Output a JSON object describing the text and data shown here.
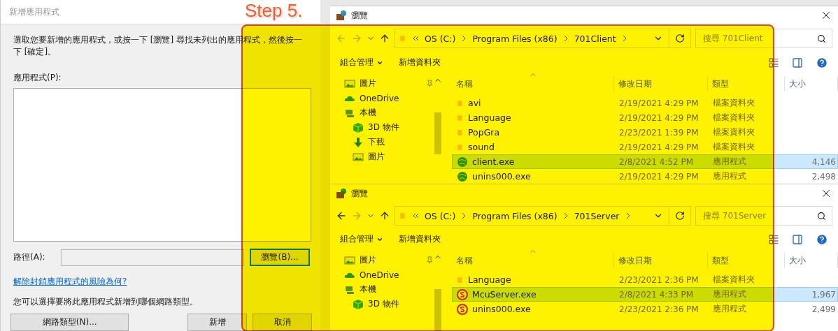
{
  "step_label": "Step 5.",
  "dialog": {
    "title": "新增應用程式",
    "instructions": "選取您要新增的應用程式，或按一下 [瀏覽] 尋找未列出的應用程式，然後按一下 [確定]。",
    "list_label": "應用程式(P):",
    "path_label": "路徑(A):",
    "browse_button": {
      "label": "瀏覽(B)...",
      "focused": true
    },
    "link": "解除封鎖應用程式的風險為何?",
    "network_note": "您可以選擇要將此應用程式新增到哪個網路類型。",
    "buttons": [
      "網路類型(N)...",
      "新增",
      "取消"
    ]
  },
  "explorers": [
    {
      "title": "瀏覽",
      "back_enabled": false,
      "breadcrumb": [
        "OS (C:)",
        "Program Files (x86)",
        "701Client"
      ],
      "search_placeholder": "搜尋 701Client",
      "toolbar": [
        "組合管理",
        "新增資料夾"
      ],
      "nav_items": [
        {
          "label": "圖片",
          "kind": "pictures",
          "pinned": true
        },
        {
          "label": "OneDrive",
          "kind": "cloud",
          "pinned": false
        },
        {
          "label": "本機",
          "kind": "pc",
          "pinned": false
        },
        {
          "label": "3D 物件",
          "kind": "cube",
          "pinned": false
        },
        {
          "label": "下載",
          "kind": "download",
          "pinned": false
        },
        {
          "label": "圖片",
          "kind": "pictures",
          "pinned": false
        }
      ],
      "columns": [
        "名稱",
        "修改日期",
        "類型",
        "大小"
      ],
      "rows": [
        {
          "name": "avi",
          "modified": "2/19/2021 4:29 PM",
          "type": "檔案資料夾",
          "kind": "folder",
          "selected": false
        },
        {
          "name": "Language",
          "modified": "2/19/2021 4:29 PM",
          "type": "檔案資料夾",
          "kind": "folder",
          "selected": false
        },
        {
          "name": "PopGra",
          "modified": "2/23/2021 1:39 PM",
          "type": "檔案資料夾",
          "kind": "folder",
          "selected": false
        },
        {
          "name": "sound",
          "modified": "2/19/2021 4:29 PM",
          "type": "檔案資料夾",
          "kind": "folder",
          "selected": false
        },
        {
          "name": "client.exe",
          "modified": "2/8/2021 4:52 PM",
          "type": "應用程式",
          "size": "4,146",
          "kind": "globe",
          "selected": true
        },
        {
          "name": "unins000.exe",
          "modified": "2/19/2021 4:29 PM",
          "type": "應用程式",
          "size": "2,498",
          "kind": "globe",
          "selected": false
        }
      ]
    },
    {
      "title": "瀏覽",
      "back_enabled": true,
      "breadcrumb": [
        "OS (C:)",
        "Program Files (x86)",
        "701Server"
      ],
      "search_placeholder": "搜尋 701Server",
      "toolbar": [
        "組合管理",
        "新增資料夾"
      ],
      "nav_items": [
        {
          "label": "圖片",
          "kind": "pictures",
          "pinned": true
        },
        {
          "label": "OneDrive",
          "kind": "cloud",
          "pinned": false
        },
        {
          "label": "本機",
          "kind": "pc",
          "pinned": false
        },
        {
          "label": "3D 物件",
          "kind": "cube",
          "pinned": false
        }
      ],
      "columns": [
        "名稱",
        "修改日期",
        "類型",
        "大小"
      ],
      "rows": [
        {
          "name": "Language",
          "modified": "2/23/2021 2:36 PM",
          "type": "檔案資料夾",
          "kind": "folder",
          "selected": false
        },
        {
          "name": "McuServer.exe",
          "modified": "2/8/2021 4:33 PM",
          "type": "應用程式",
          "size": "1,967",
          "kind": "server",
          "selected": true
        },
        {
          "name": "unins000.exe",
          "modified": "2/23/2021 2:36 PM",
          "type": "應用程式",
          "size": "2,499",
          "kind": "server",
          "selected": false
        }
      ]
    }
  ]
}
